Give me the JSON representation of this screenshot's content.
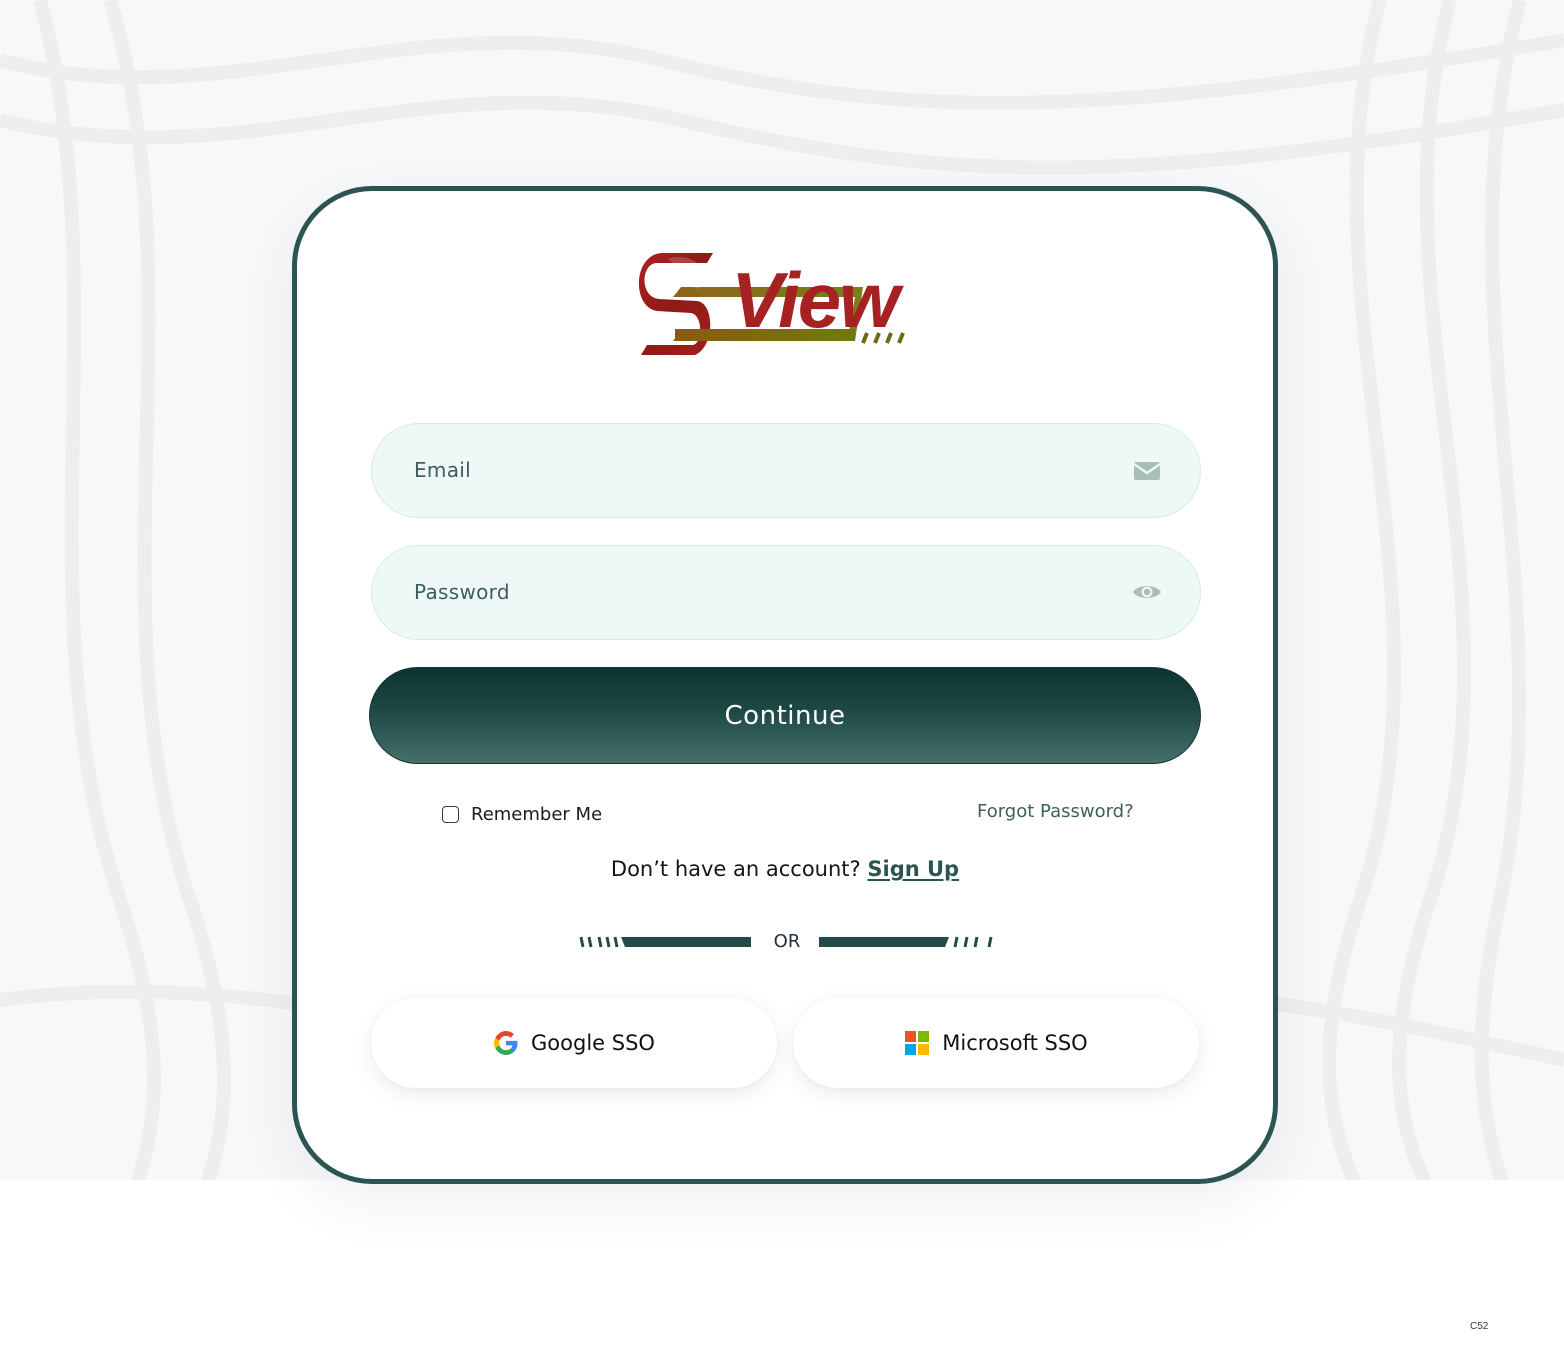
{
  "brand": {
    "logo_text": "SView",
    "colors": {
      "logo_red": "#a51f1f",
      "logo_olive": "#7a6a14",
      "primary": "#1e4844",
      "field_bg": "#eef8f6"
    }
  },
  "form": {
    "email": {
      "placeholder": "Email",
      "icon": "envelope-icon"
    },
    "password": {
      "placeholder": "Password",
      "icon": "eye-icon"
    },
    "continue_label": "Continue"
  },
  "options": {
    "remember_label": "Remember Me",
    "remember_checked": false,
    "forgot_label": "Forgot Password?"
  },
  "signup": {
    "prompt": "Don’t have an account?",
    "link_label": "Sign Up"
  },
  "divider": {
    "label": "OR"
  },
  "sso": {
    "google_label": "Google SSO",
    "google_icon": "google-icon",
    "microsoft_label": "Microsoft SSO",
    "microsoft_icon": "microsoft-icon"
  },
  "footer": {
    "corner_code": "C52"
  }
}
